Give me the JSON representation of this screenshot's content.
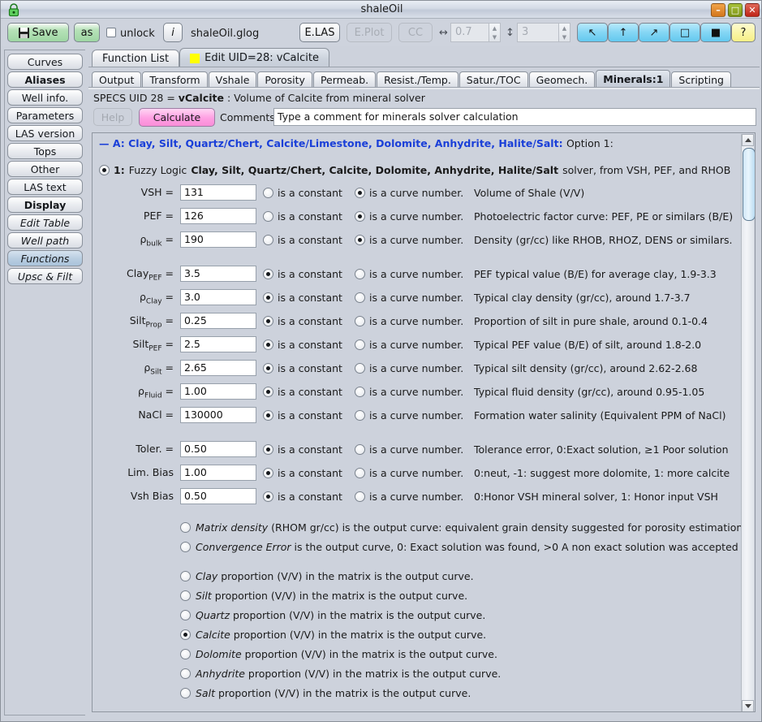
{
  "window": {
    "title": "shaleOil",
    "lock_icon": "padlock-icon",
    "minimize": "–",
    "maximize": "□",
    "close": "✕"
  },
  "toolbar": {
    "save_label": "Save",
    "save_as_label": "as",
    "unlock_label": "unlock",
    "info_label": "i",
    "filename": "shaleOil.glog",
    "export_las_label": "E.LAS",
    "export_plot_label": "E.Plot",
    "cc_label": "CC",
    "hscale_symbol": "↔",
    "hscale_value": "0.7",
    "vscale_symbol": "↕",
    "vscale_value": "3",
    "tool_buttons": [
      {
        "name": "arrow-up-left-icon",
        "glyph": "↖"
      },
      {
        "name": "arrow-up-icon",
        "glyph": "↑"
      },
      {
        "name": "arrow-up-right-icon",
        "glyph": "↗"
      },
      {
        "name": "square-outline-icon",
        "glyph": "□"
      },
      {
        "name": "square-filled-icon",
        "glyph": "■"
      },
      {
        "name": "help-question-icon",
        "glyph": "?"
      }
    ]
  },
  "sidebar": {
    "items": [
      {
        "label": "Curves",
        "style": "normal",
        "selected": false
      },
      {
        "label": "Aliases",
        "style": "bold",
        "selected": false
      },
      {
        "label": "Well info.",
        "style": "normal",
        "selected": false
      },
      {
        "label": "Parameters",
        "style": "normal",
        "selected": false
      },
      {
        "label": "LAS version",
        "style": "normal",
        "selected": false
      },
      {
        "label": "Tops",
        "style": "normal",
        "selected": false
      },
      {
        "label": "Other",
        "style": "normal",
        "selected": false
      },
      {
        "label": "LAS text",
        "style": "normal",
        "selected": false
      },
      {
        "label": "Display",
        "style": "bold",
        "selected": false
      },
      {
        "label": "Edit Table",
        "style": "italic",
        "selected": false
      },
      {
        "label": "Well path",
        "style": "italic",
        "selected": false
      },
      {
        "label": "Functions",
        "style": "italic",
        "selected": true
      },
      {
        "label": "Upsc & Filt",
        "style": "italic",
        "selected": false
      }
    ]
  },
  "tabs_primary": [
    {
      "label": "Function List",
      "active": false,
      "icon": ""
    },
    {
      "label": "Edit UID=28: vCalcite",
      "active": true,
      "icon": "yellow-square-icon"
    }
  ],
  "tabs_secondary": [
    {
      "label": "Output",
      "active": false
    },
    {
      "label": "Transform",
      "active": false
    },
    {
      "label": "Vshale",
      "active": false
    },
    {
      "label": "Porosity",
      "active": false
    },
    {
      "label": "Permeab.",
      "active": false
    },
    {
      "label": "Resist./Temp.",
      "active": false
    },
    {
      "label": "Satur./TOC",
      "active": false
    },
    {
      "label": "Geomech.",
      "active": false
    },
    {
      "label": "Minerals:1",
      "active": true
    },
    {
      "label": "Scripting",
      "active": false
    }
  ],
  "specs": {
    "prefix": "SPECS UID 28 = ",
    "name": "vCalcite",
    "suffix": " : Volume of Calcite from mineral solver"
  },
  "actions": {
    "help_label": "Help",
    "calculate_label": "Calculate",
    "comments_label": "Comments:",
    "comment_value": "Type a comment for minerals solver calculation",
    "comment_placeholder": "Type a comment for minerals solver calculation"
  },
  "content": {
    "option_header": "— A: Clay, Silt, Quartz/Chert, Calcite/Limestone, Dolomite, Anhydrite, Halite/Salt:",
    "option_header_suffix": "Option 1:",
    "method": {
      "number": "1:",
      "prefix": "Fuzzy Logic",
      "minerals": "Clay, Silt, Quartz/Chert, Calcite, Dolomite, Anhydrite, Halite/Salt",
      "suffix": "solver, from VSH, PEF, and RHOB",
      "selected": true
    },
    "const_label": "is a constant",
    "curve_label": "is a curve number.",
    "params": [
      {
        "label": "VSH =",
        "sub": "",
        "base": "VSH",
        "value": "131",
        "mode": "curve",
        "desc": "Volume of Shale (V/V)"
      },
      {
        "label": "PEF =",
        "sub": "",
        "base": "PEF",
        "value": "126",
        "mode": "curve",
        "desc": "Photoelectric factor curve: PEF, PE or similars (B/E)"
      },
      {
        "label": "",
        "sub": "bulk",
        "base": "ρ",
        "value": "190",
        "mode": "curve",
        "desc": "Density (gr/cc) like RHOB, RHOZ, DENS or similars."
      },
      {
        "label": "",
        "sub": "PEF",
        "base": "Clay",
        "value": "3.5",
        "mode": "constant",
        "desc": "PEF typical value (B/E) for average clay, 1.9-3.3"
      },
      {
        "label": "",
        "sub": "Clay",
        "base": "ρ",
        "value": "3.0",
        "mode": "constant",
        "desc": "Typical clay density (gr/cc), around 1.7-3.7"
      },
      {
        "label": "",
        "sub": "Prop",
        "base": "Silt",
        "value": "0.25",
        "mode": "constant",
        "desc": "Proportion of silt in pure shale, around 0.1-0.4"
      },
      {
        "label": "",
        "sub": "PEF",
        "base": "Silt",
        "value": "2.5",
        "mode": "constant",
        "desc": "Typical PEF value (B/E) of silt, around 1.8-2.0"
      },
      {
        "label": "",
        "sub": "Silt",
        "base": "ρ",
        "value": "2.65",
        "mode": "constant",
        "desc": "Typical silt density (gr/cc), around 2.62-2.68"
      },
      {
        "label": "",
        "sub": "Fluid",
        "base": "ρ",
        "value": "1.00",
        "mode": "constant",
        "desc": "Typical fluid density (gr/cc), around 0.95-1.05"
      },
      {
        "label": "NaCl =",
        "sub": "",
        "base": "NaCl",
        "value": "130000",
        "mode": "constant",
        "desc": "Formation water salinity (Equivalent PPM of NaCl)"
      },
      {
        "label": "Toler. =",
        "sub": "",
        "base": "Toler.",
        "value": "0.50",
        "mode": "constant",
        "desc": "Tolerance error, 0:Exact solution, ≥1 Poor solution"
      },
      {
        "label": "Lim. Bias",
        "sub": "",
        "base": "Lim. Bias",
        "value": "1.00",
        "mode": "constant",
        "desc": "0:neut, -1: suggest more dolomite, 1: more calcite"
      },
      {
        "label": "Vsh Bias",
        "sub": "",
        "base": "Vsh Bias",
        "value": "0.50",
        "mode": "constant",
        "desc": "0:Honor VSH mineral solver, 1: Honor input VSH"
      }
    ],
    "outputs": [
      {
        "em": "Matrix density",
        "rest": " (RHOM gr/cc) is the output curve: equivalent grain density suggested for porosity estimation",
        "selected": false
      },
      {
        "em": "Convergence Error",
        "rest": " is the output curve, 0: Exact solution was found, >0 A non exact solution was accepted",
        "selected": false
      },
      {
        "em": "Clay",
        "rest": " proportion (V/V) in the matrix is the output curve.",
        "selected": false
      },
      {
        "em": "Silt",
        "rest": " proportion (V/V) in the matrix is the output curve.",
        "selected": false
      },
      {
        "em": "Quartz",
        "rest": " proportion (V/V) in the matrix is the output curve.",
        "selected": false
      },
      {
        "em": "Calcite",
        "rest": " proportion (V/V) in the matrix is the output curve.",
        "selected": true
      },
      {
        "em": "Dolomite",
        "rest": " proportion (V/V) in the matrix is the output curve.",
        "selected": false
      },
      {
        "em": "Anhydrite",
        "rest": " proportion (V/V) in the matrix is the output curve.",
        "selected": false
      },
      {
        "em": "Salt",
        "rest": " proportion (V/V) in the matrix is the output curve.",
        "selected": false
      }
    ]
  },
  "colors": {
    "accent_blue": "#1a3fd8",
    "calculate_pink": "#ff9fe2",
    "save_green": "#9ed6a3",
    "tool_cyan": "#84d6f4",
    "help_yellow": "#faf5a8",
    "tab_highlight": "#ffff00",
    "window_bg": "#cdd2dc"
  }
}
